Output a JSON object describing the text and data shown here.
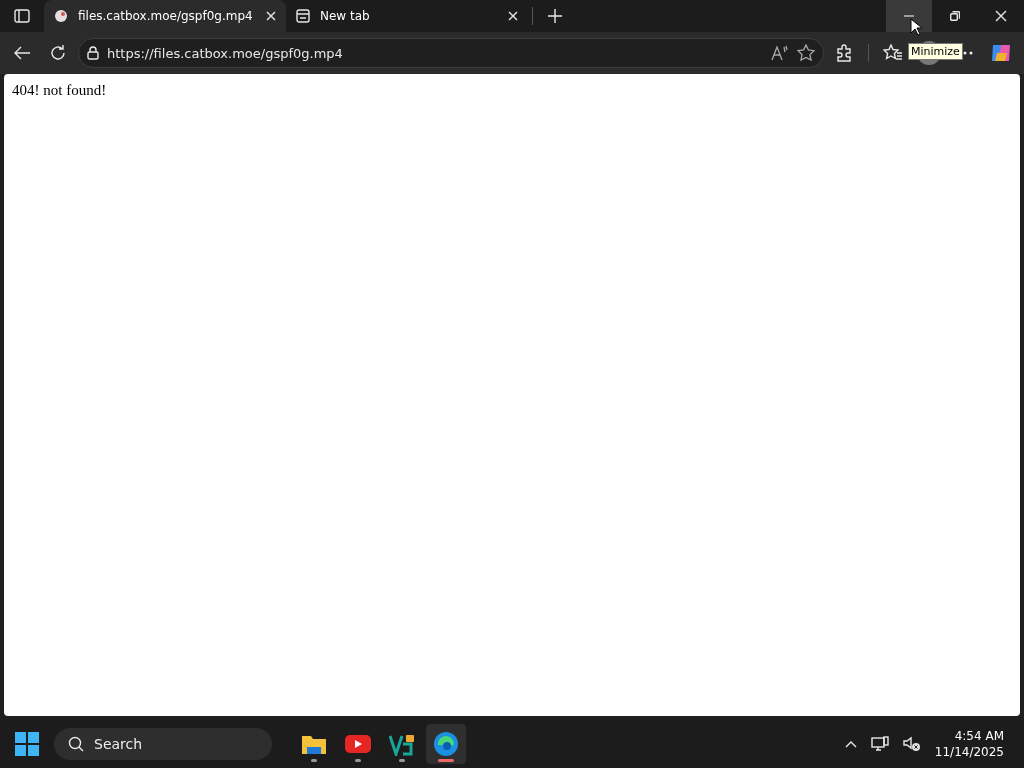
{
  "tabs": [
    {
      "title": "files.catbox.moe/gspf0g.mp4",
      "selected": true
    },
    {
      "title": "New tab",
      "selected": false
    }
  ],
  "address_bar": {
    "url": "https://files.catbox.moe/gspf0g.mp4"
  },
  "tooltip": "Minimize",
  "page": {
    "text": "404! not found!"
  },
  "taskbar": {
    "search": {
      "placeholder": "Search"
    },
    "apps": [
      {
        "kind": "folder",
        "selected": false
      },
      {
        "kind": "video",
        "selected": false
      },
      {
        "kind": "vpn",
        "selected": false
      },
      {
        "kind": "browser",
        "selected": true
      }
    ],
    "time": "4:54 AM",
    "date": "11/14/2025"
  }
}
